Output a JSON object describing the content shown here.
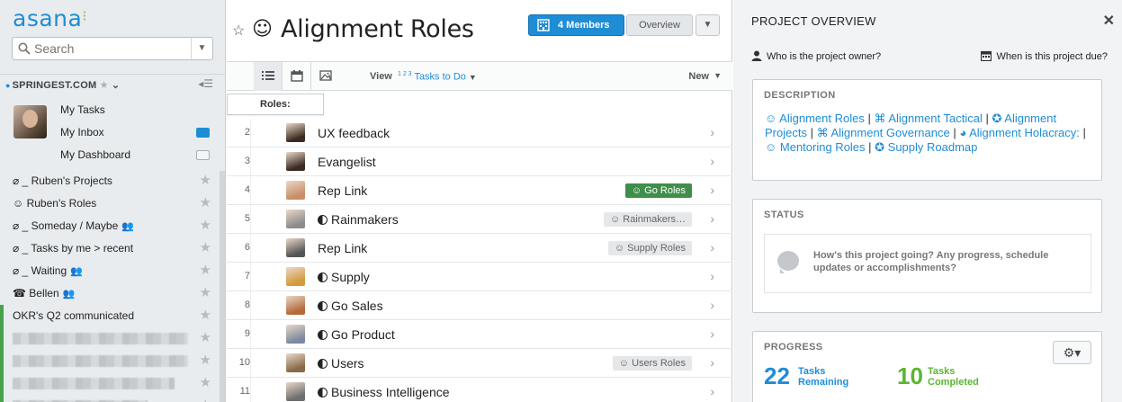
{
  "sidebar": {
    "logo": "asana",
    "search": {
      "placeholder": "Search"
    },
    "workspace": "SPRINGEST.COM",
    "my_links": [
      {
        "label": "My Tasks"
      },
      {
        "label": "My Inbox"
      },
      {
        "label": "My Dashboard"
      }
    ],
    "projects": [
      {
        "label": "⌀ _ Ruben's Projects",
        "shared": false,
        "color": ""
      },
      {
        "label": "☺ Ruben's Roles",
        "shared": false,
        "color": ""
      },
      {
        "label": "⌀ _ Someday / Maybe",
        "shared": true,
        "color": ""
      },
      {
        "label": "⌀ _ Tasks by me > recent",
        "shared": false,
        "color": ""
      },
      {
        "label": "⌀ _ Waiting",
        "shared": true,
        "color": ""
      },
      {
        "label": "☎ Bellen",
        "shared": true,
        "color": ""
      },
      {
        "label": "OKR's Q2 communicated",
        "shared": false,
        "color": "#47a24d"
      },
      {
        "label": "",
        "blurred": true,
        "color": "#47a24d"
      },
      {
        "label": "",
        "blurred": true,
        "color": "#47a24d"
      },
      {
        "label": "",
        "blurred": true,
        "color": "#47a24d"
      },
      {
        "label": "",
        "blurred": true,
        "color": "#47a24d"
      }
    ]
  },
  "main": {
    "project_icon": "☺",
    "title": "Alignment Roles",
    "members_label": "4 Members",
    "overview_label": "Overview",
    "view_label": "View",
    "view_value": "Tasks to Do",
    "view_sup": "1 2 3",
    "new_label": "New",
    "section_header": "Roles:",
    "tasks": [
      {
        "num": "2",
        "name": "UX feedback",
        "role_icon": false,
        "tag": "",
        "tag_style": "",
        "avatar": "#3a2a20"
      },
      {
        "num": "3",
        "name": "Evangelist",
        "role_icon": false,
        "tag": "",
        "tag_style": "",
        "avatar": "#3a2a20"
      },
      {
        "num": "4",
        "name": "Rep Link",
        "role_icon": false,
        "tag": "☺ Go Roles",
        "tag_style": "green",
        "avatar": "#c98e66"
      },
      {
        "num": "5",
        "name": "Rainmakers",
        "role_icon": true,
        "tag": "☺ Rainmakers…",
        "tag_style": "grey",
        "avatar": "#8c8c8c"
      },
      {
        "num": "6",
        "name": "Rep Link",
        "role_icon": false,
        "tag": "☺ Supply Roles",
        "tag_style": "grey",
        "avatar": "#555555"
      },
      {
        "num": "7",
        "name": "Supply",
        "role_icon": true,
        "tag": "",
        "tag_style": "",
        "avatar": "#d49a3c"
      },
      {
        "num": "8",
        "name": "Go Sales",
        "role_icon": true,
        "tag": "",
        "tag_style": "",
        "avatar": "#b56a3a"
      },
      {
        "num": "9",
        "name": "Go Product",
        "role_icon": true,
        "tag": "",
        "tag_style": "",
        "avatar": "#7c8aa0"
      },
      {
        "num": "10",
        "name": "Users",
        "role_icon": true,
        "tag": "☺ Users Roles",
        "tag_style": "grey",
        "avatar": "#8a6a4a"
      },
      {
        "num": "11",
        "name": "Business Intelligence",
        "role_icon": true,
        "tag": "",
        "tag_style": "",
        "avatar": "#6e6e6e"
      }
    ]
  },
  "panel": {
    "title": "PROJECT OVERVIEW",
    "owner_prompt": "Who is the project owner?",
    "due_prompt": "When is this project due?",
    "description_heading": "DESCRIPTION",
    "description_links": [
      {
        "text": "☺ Alignment Roles"
      },
      {
        "text": "⌘ Alignment Tactical"
      },
      {
        "text": "✪ Alignment Projects"
      },
      {
        "text": "⌘ Alignment Governance"
      },
      {
        "text": "◕ Alignment Holacracy:"
      },
      {
        "text": "☺ Mentoring Roles"
      },
      {
        "text": "✪ Supply Roadmap"
      }
    ],
    "status_heading": "STATUS",
    "status_placeholder": "How's this project going? Any progress, schedule updates or accomplishments?",
    "progress_heading": "PROGRESS",
    "remaining_count": "22",
    "remaining_label_1": "Tasks",
    "remaining_label_2": "Remaining",
    "completed_count": "10",
    "completed_label_1": "Tasks",
    "completed_label_2": "Completed",
    "colors": {
      "remaining": "#1f8dd6",
      "completed": "#5cb531"
    }
  }
}
